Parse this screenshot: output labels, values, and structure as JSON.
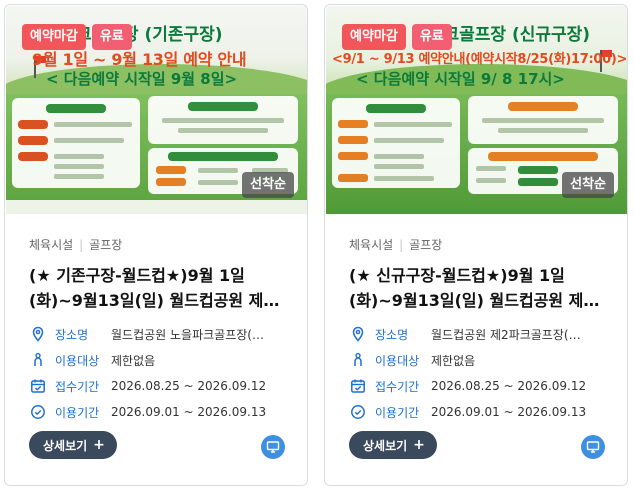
{
  "cards": [
    {
      "badges": {
        "closed": "예약마감",
        "paid": "유료"
      },
      "poster": {
        "title": "크골프장 (기존구장)",
        "line1": "9월 1일 ~ 9월 13일 예약 안내",
        "line2": "< 다음예약 시작일 9월 8일>"
      },
      "first_come": "선착순",
      "category": "체육시설",
      "subcategory": "골프장",
      "title_line1": "(★ 기존구장-월드컵★)9월 1일",
      "title_line2": "(화)~9월13일(일) 월드컵공원 제…",
      "info": {
        "place_label": "장소명",
        "place": "월드컵공원 노을파크골프장(…",
        "target_label": "이용대상",
        "target": "제한없음",
        "apply_label": "접수기간",
        "apply": "2026.08.25 ~ 2026.09.12",
        "use_label": "이용기간",
        "use": "2026.09.01 ~ 2026.09.13"
      },
      "detail_label": "상세보기",
      "detail_plus": "+"
    },
    {
      "badges": {
        "closed": "예약마감",
        "paid": "유료"
      },
      "poster": {
        "title": "2파크골프장 (신규구장)",
        "line1": "<9/1 ~ 9/13 예약안내(예약시작8/25(화)17:00)>",
        "line2": "< 다음예약 시작일 9/ 8 17시>"
      },
      "first_come": "선착순",
      "category": "체육시설",
      "subcategory": "골프장",
      "title_line1": "(★ 신규구장-월드컵★)9월 1일",
      "title_line2": "(화)~9월13일(일) 월드컵공원 제…",
      "info": {
        "place_label": "장소명",
        "place": "월드컵공원 제2파크골프장(…",
        "target_label": "이용대상",
        "target": "제한없음",
        "apply_label": "접수기간",
        "apply": "2026.08.25 ~ 2026.09.12",
        "use_label": "이용기간",
        "use": "2026.09.01 ~ 2026.09.13"
      },
      "detail_label": "상세보기",
      "detail_plus": "+"
    }
  ],
  "icons": {
    "place": "location-pin-icon",
    "target": "person-icon",
    "apply": "calendar-icon",
    "use": "clock-icon",
    "online": "monitor-icon"
  },
  "colors": {
    "badge_closed": "#f2555a",
    "badge_paid": "#f25f72",
    "label_blue": "#1f6fd1",
    "detail_button": "#3a4a5c",
    "online_icon": "#3f8fe0"
  }
}
